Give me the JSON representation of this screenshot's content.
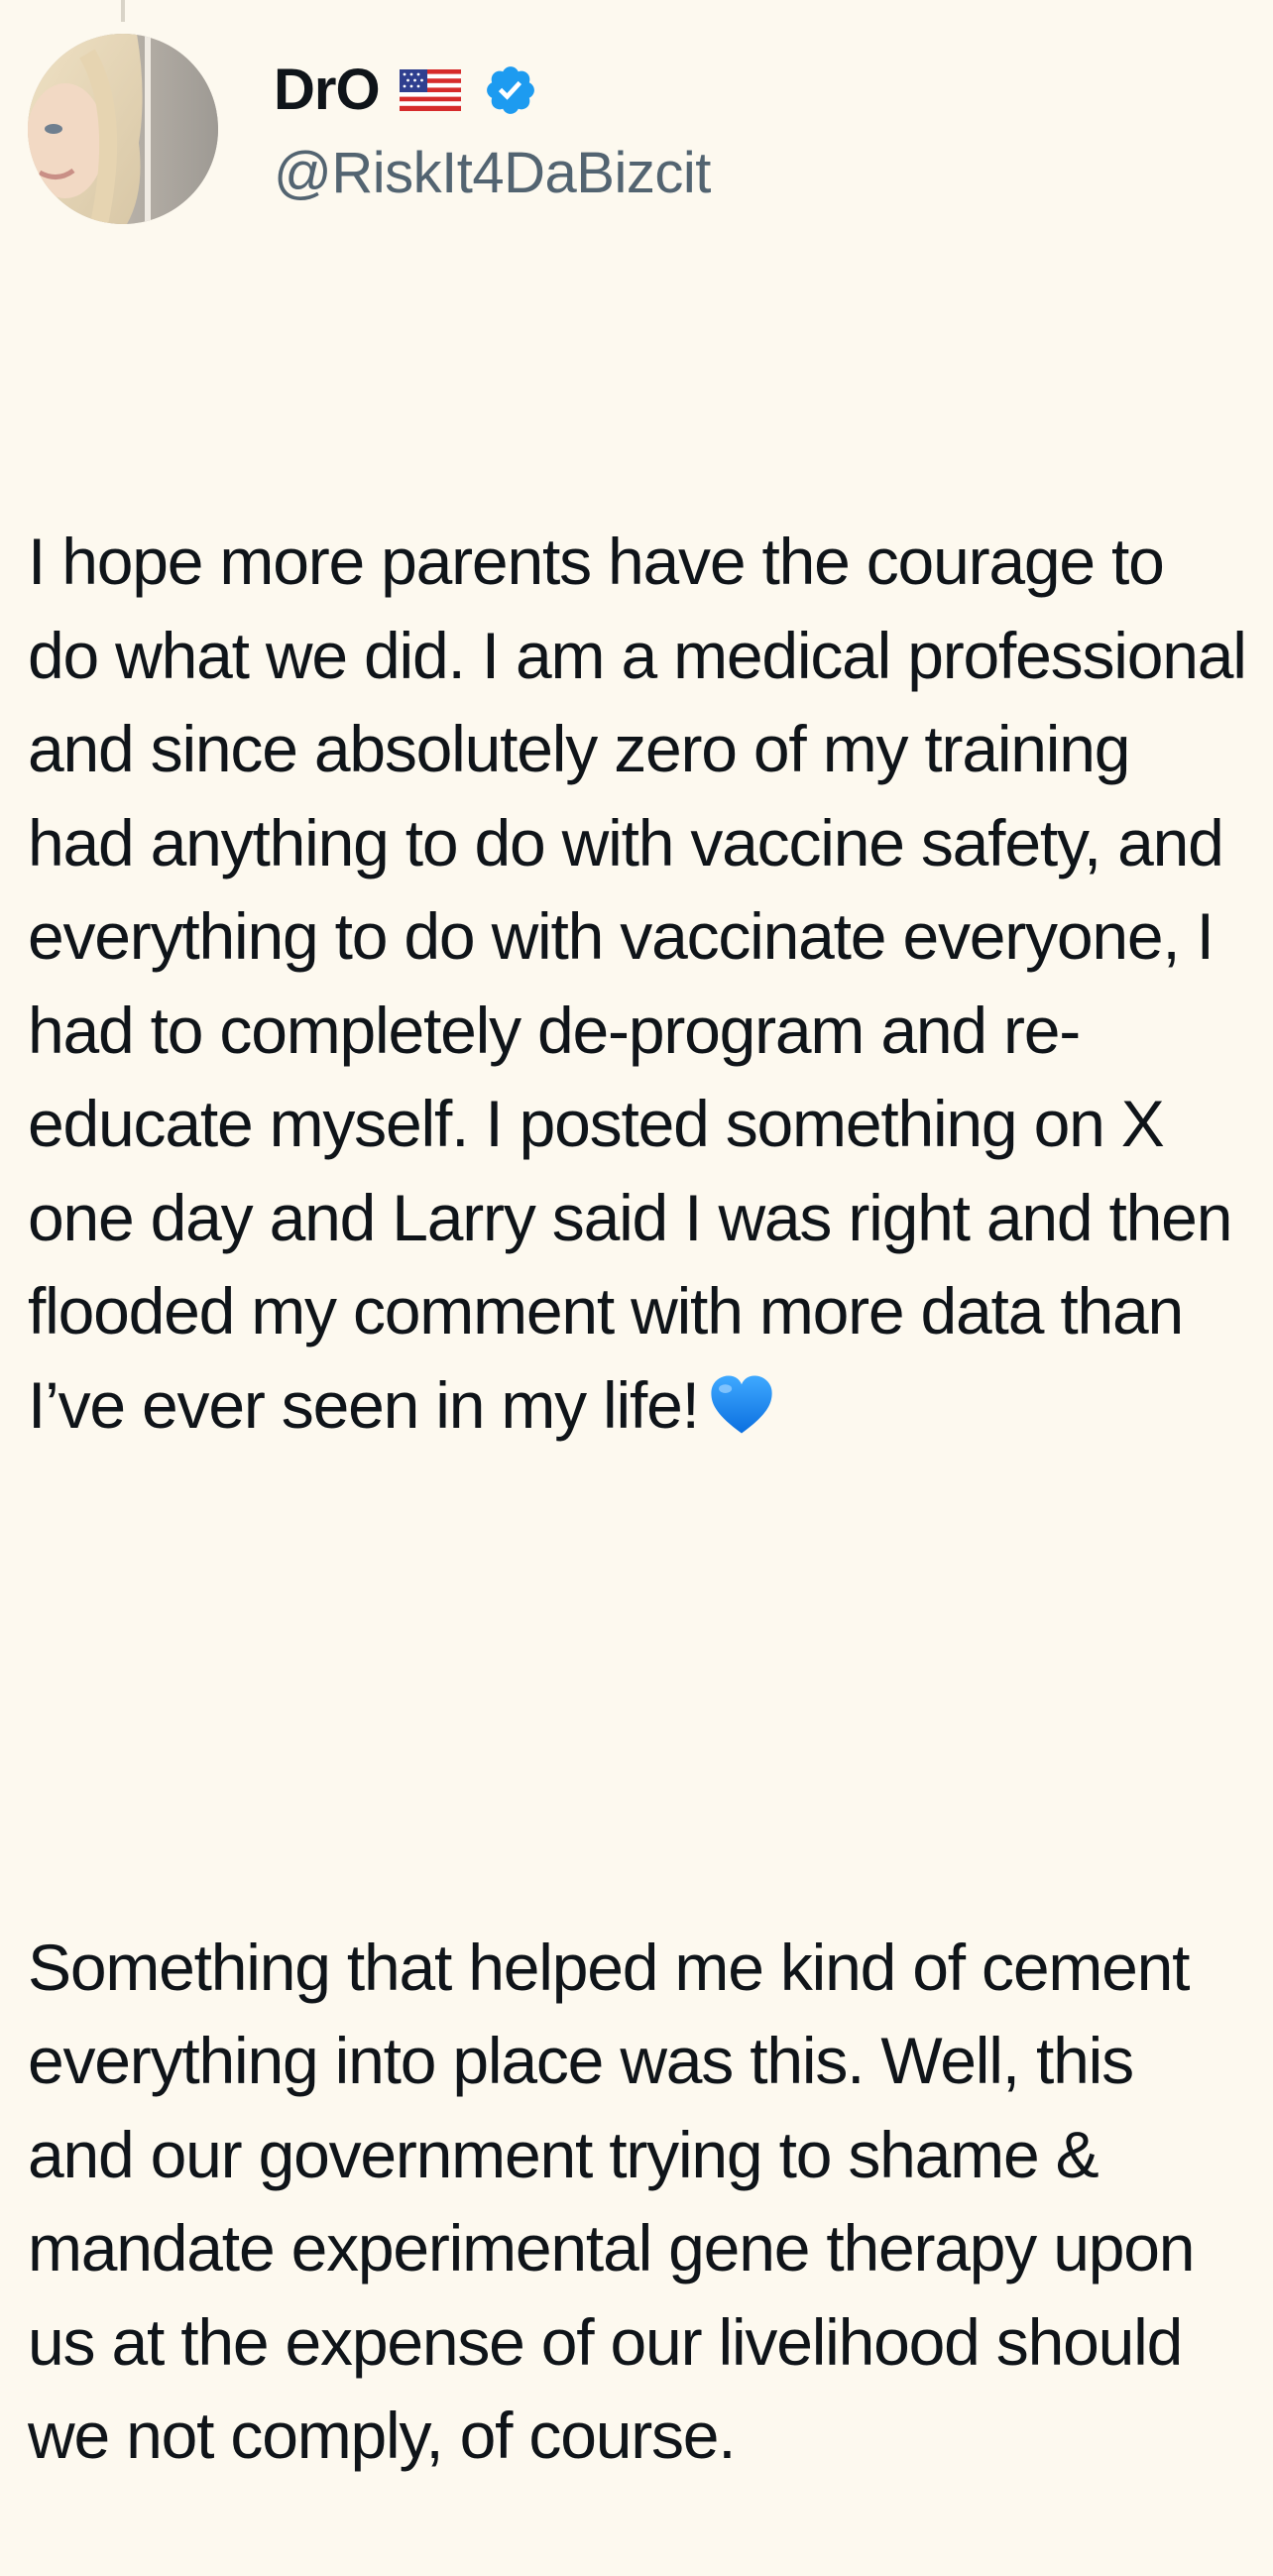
{
  "tweet": {
    "author": {
      "display_name": "DrO",
      "flag_icon": "us-flag-icon",
      "verified_icon": "verified-badge-icon",
      "handle": "@RiskIt4DaBizcit"
    },
    "paragraph_1": "I hope more parents have the courage to do what we did. I am a medical professional and since absolutely zero of my training had anything to do with vaccine safety, and everything to do with vaccinate everyone, I had to completely de-program and re-educate myself. I posted something on X one day and Larry said I was right and then flooded my comment with more data than I’ve ever seen in my life!",
    "paragraph_1_emoji": "blue-heart-icon",
    "paragraph_2": "Something that helped me kind of cement everything into place was this. Well, this and our government trying to shame & mandate experimental gene therapy upon us at the expense of our livelihood should we not comply, of course."
  },
  "colors": {
    "background": "#fdf9ef",
    "text": "#0f1419",
    "handle": "#536471",
    "verified": "#1d9bf0",
    "heart": "#1e90ff"
  }
}
